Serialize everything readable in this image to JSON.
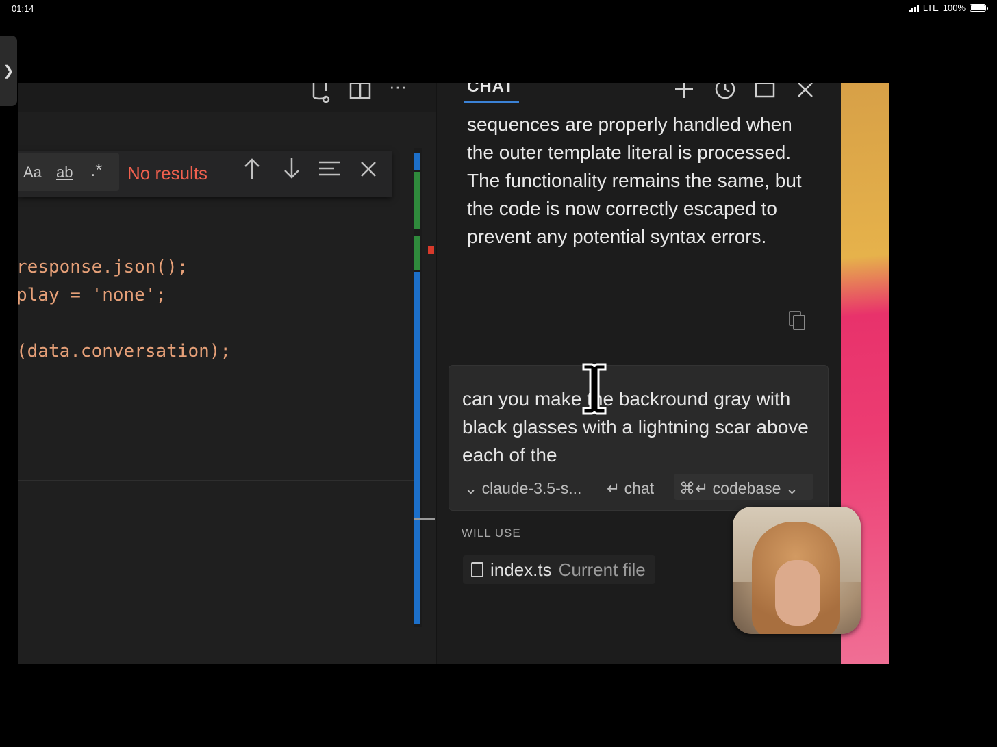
{
  "status_bar": {
    "time": "01:14",
    "network": "LTE",
    "battery": "100%",
    "battery_level": 1.0
  },
  "editor": {
    "find": {
      "match_case": "Aa",
      "match_word": "ab",
      "regex": ".*",
      "result": "No results"
    },
    "code_lines": [
      "response.json();",
      "play = 'none';",
      "",
      "(data.conversation);"
    ]
  },
  "chat": {
    "tab_label": "CHAT",
    "message": "sequences are properly handled when the outer template literal is processed. The functionality remains the same, but the code is now correctly escaped to prevent any potential syntax errors.",
    "input": {
      "text": "can you make the backround gray with black glasses with a lightning scar above each of the",
      "model": "claude-3.5-s...",
      "chat_label": "chat",
      "chat_shortcut": "↵",
      "codebase_shortcut": "⌘↵",
      "codebase_label": "codebase"
    },
    "will_use_label": "WILL USE",
    "context_file": {
      "name": "index.ts",
      "desc": "Current file"
    }
  },
  "colors": {
    "accent_blue": "#3b82d6",
    "no_results": "#f1604e",
    "code_string": "#e6a078"
  }
}
